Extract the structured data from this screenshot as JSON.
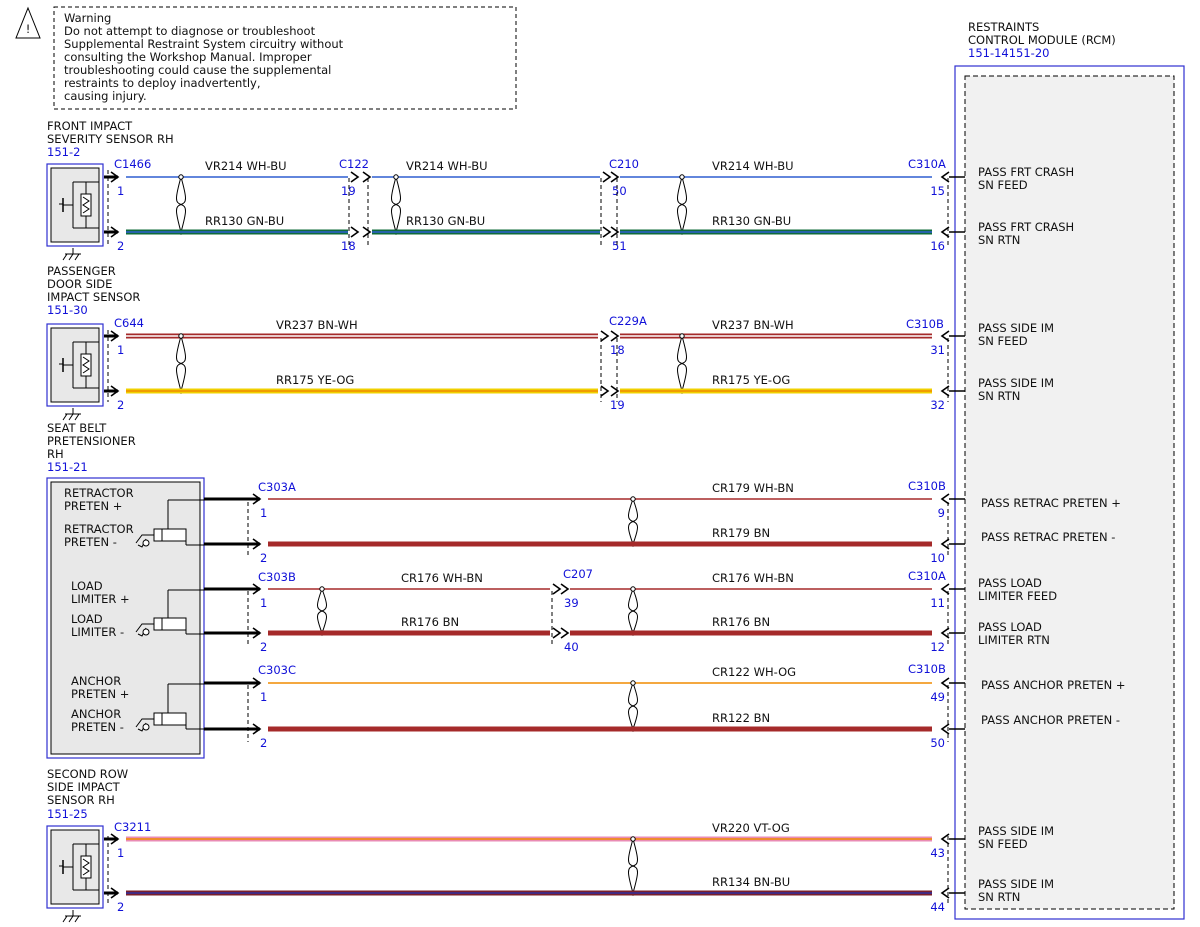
{
  "warning": {
    "lines": [
      "Warning",
      "Do not attempt to diagnose or troubleshoot",
      "Supplemental Restraint System circuitry without",
      "consulting the Workshop Manual. Improper",
      "troubleshooting could cause the supplemental",
      "restraints to deploy inadvertently,",
      "causing injury."
    ]
  },
  "rcm": {
    "title_lines": [
      "RESTRAINTS",
      "CONTROL MODULE (RCM)"
    ],
    "ref": "151-14151-20"
  },
  "components": [
    {
      "id": "front-impact-sensor",
      "title_lines": [
        "FRONT IMPACT",
        "SEVERITY SENSOR RH"
      ],
      "ref": "151-2",
      "type": "sensor"
    },
    {
      "id": "passenger-door-sensor",
      "title_lines": [
        "PASSENGER",
        "DOOR SIDE",
        "IMPACT SENSOR"
      ],
      "ref": "151-30",
      "type": "sensor"
    },
    {
      "id": "seat-belt-pretensioner",
      "title_lines": [
        "SEAT BELT",
        "PRETENSIONER",
        "RH"
      ],
      "ref": "151-21",
      "type": "pretensioner"
    },
    {
      "id": "second-row-sensor",
      "title_lines": [
        "SECOND ROW",
        "SIDE IMPACT",
        "SENSOR RH"
      ],
      "ref": "151-25",
      "type": "sensor"
    }
  ],
  "pretensioner_labels": [
    [
      "RETRACTOR",
      "PRETEN +"
    ],
    [
      "RETRACTOR",
      "PRETEN -"
    ],
    [
      "LOAD",
      "LIMITER +"
    ],
    [
      "LOAD",
      "LIMITER -"
    ],
    [
      "ANCHOR",
      "PRETEN +"
    ],
    [
      "ANCHOR",
      "PRETEN -"
    ]
  ],
  "connectors": [
    {
      "name": "C1466"
    },
    {
      "name": "C122"
    },
    {
      "name": "C210"
    },
    {
      "name": "C310A"
    },
    {
      "name": "C644"
    },
    {
      "name": "C229A"
    },
    {
      "name": "C310B"
    },
    {
      "name": "C303A"
    },
    {
      "name": "C310B"
    },
    {
      "name": "C303B"
    },
    {
      "name": "C207"
    },
    {
      "name": "C310A"
    },
    {
      "name": "C303C"
    },
    {
      "name": "C310B"
    },
    {
      "name": "C3211"
    }
  ],
  "circuits": [
    {
      "pins": [
        "1",
        "19",
        "50",
        "15"
      ],
      "segments": [
        {
          "circuit": "VR214",
          "color_code": "WH-BU",
          "colors": [
            "#ffffff",
            "#2f5fd0"
          ]
        },
        {
          "circuit": "VR214",
          "color_code": "WH-BU",
          "colors": [
            "#ffffff",
            "#2f5fd0"
          ]
        },
        {
          "circuit": "VR214",
          "color_code": "WH-BU",
          "colors": [
            "#ffffff",
            "#2f5fd0"
          ]
        }
      ],
      "rcm_label": [
        "PASS FRT CRASH",
        "SN FEED"
      ]
    },
    {
      "pins": [
        "2",
        "18",
        "51",
        "16"
      ],
      "segments": [
        {
          "circuit": "RR130",
          "color_code": "GN-BU",
          "colors": [
            "#0f6b3a",
            "#2f5fd0"
          ]
        },
        {
          "circuit": "RR130",
          "color_code": "GN-BU",
          "colors": [
            "#0f6b3a",
            "#2f5fd0"
          ]
        },
        {
          "circuit": "RR130",
          "color_code": "GN-BU",
          "colors": [
            "#0f6b3a",
            "#2f5fd0"
          ]
        }
      ],
      "rcm_label": [
        "PASS FRT CRASH",
        "SN RTN"
      ]
    },
    {
      "pins": [
        "1",
        "18",
        "31"
      ],
      "segments": [
        {
          "circuit": "VR237",
          "color_code": "BN-WH",
          "colors": [
            "#a52a2a",
            "#ffffff"
          ]
        },
        {
          "circuit": "VR237",
          "color_code": "BN-WH",
          "colors": [
            "#a52a2a",
            "#ffffff"
          ]
        }
      ],
      "rcm_label": [
        "PASS SIDE IM",
        "SN FEED"
      ]
    },
    {
      "pins": [
        "2",
        "19",
        "32"
      ],
      "segments": [
        {
          "circuit": "RR175",
          "color_code": "YE-OG",
          "colors": [
            "#f0d000",
            "#f08c00"
          ]
        },
        {
          "circuit": "RR175",
          "color_code": "YE-OG",
          "colors": [
            "#f0d000",
            "#f08c00"
          ]
        }
      ],
      "rcm_label": [
        "PASS SIDE IM",
        "SN RTN"
      ]
    },
    {
      "pins": [
        "1",
        "9"
      ],
      "segments": [
        {
          "circuit": "CR179",
          "color_code": "WH-BN",
          "colors": [
            "#ffffff",
            "#a52a2a"
          ]
        }
      ],
      "rcm_label": [
        "PASS RETRAC PRETEN +"
      ]
    },
    {
      "pins": [
        "2",
        "10"
      ],
      "segments": [
        {
          "circuit": "RR179",
          "color_code": "BN",
          "colors": [
            "#a52a2a"
          ]
        }
      ],
      "rcm_label": [
        "PASS RETRAC PRETEN -"
      ]
    },
    {
      "pins": [
        "1",
        "39",
        "11"
      ],
      "segments": [
        {
          "circuit": "CR176",
          "color_code": "WH-BN",
          "colors": [
            "#ffffff",
            "#a52a2a"
          ]
        },
        {
          "circuit": "CR176",
          "color_code": "WH-BN",
          "colors": [
            "#ffffff",
            "#a52a2a"
          ]
        }
      ],
      "rcm_label": [
        "PASS LOAD",
        "LIMITER FEED"
      ]
    },
    {
      "pins": [
        "2",
        "40",
        "12"
      ],
      "segments": [
        {
          "circuit": "RR176",
          "color_code": "BN",
          "colors": [
            "#a52a2a"
          ]
        },
        {
          "circuit": "RR176",
          "color_code": "BN",
          "colors": [
            "#a52a2a"
          ]
        }
      ],
      "rcm_label": [
        "PASS LOAD",
        "LIMITER RTN"
      ]
    },
    {
      "pins": [
        "1",
        "49"
      ],
      "segments": [
        {
          "circuit": "CR122",
          "color_code": "WH-OG",
          "colors": [
            "#ffffff",
            "#f08c00"
          ]
        }
      ],
      "rcm_label": [
        "PASS ANCHOR PRETEN +"
      ]
    },
    {
      "pins": [
        "2",
        "50"
      ],
      "segments": [
        {
          "circuit": "RR122",
          "color_code": "BN",
          "colors": [
            "#a52a2a"
          ]
        }
      ],
      "rcm_label": [
        "PASS ANCHOR PRETEN -"
      ]
    },
    {
      "pins": [
        "1",
        "43"
      ],
      "segments": [
        {
          "circuit": "VR220",
          "color_code": "VT-OG",
          "colors": [
            "#e98bb4",
            "#f08c00"
          ]
        }
      ],
      "rcm_label": [
        "PASS SIDE IM",
        "SN FEED"
      ]
    },
    {
      "pins": [
        "2",
        "44"
      ],
      "segments": [
        {
          "circuit": "RR134",
          "color_code": "BN-BU",
          "colors": [
            "#7a1f2b",
            "#2f2fa0"
          ]
        }
      ],
      "rcm_label": [
        "PASS SIDE IM",
        "SN RTN"
      ]
    }
  ]
}
